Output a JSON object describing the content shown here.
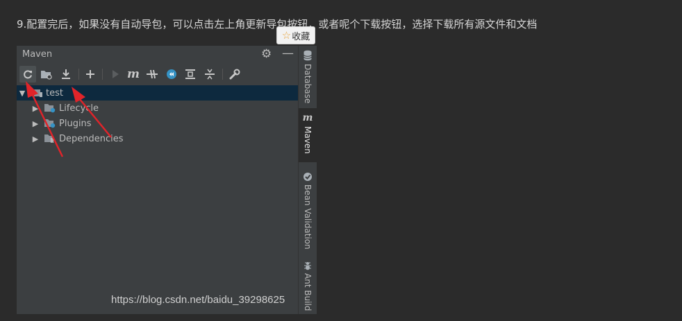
{
  "intro_text": "9.配置完后，如果没有自动导包，可以点击左上角更新导包按钮，或者呢个下载按钮，选择下载所有源文件和文档",
  "collect": {
    "star_icon": "☆",
    "label": "收藏"
  },
  "panel": {
    "title": "Maven"
  },
  "tree": {
    "root": {
      "label": "test"
    },
    "children": [
      {
        "label": "Lifecycle"
      },
      {
        "label": "Plugins"
      },
      {
        "label": "Dependencies"
      }
    ]
  },
  "side_tabs": [
    {
      "label": "Database"
    },
    {
      "label": "Maven"
    },
    {
      "label": "Bean Validation"
    },
    {
      "label": "Ant Build"
    }
  ],
  "watermark": "https://blog.csdn.net/baidu_39298625",
  "colors": {
    "background": "#2b2b2b",
    "panel": "#3c3f41",
    "selected_row": "#0d293e",
    "annotation_red": "#e0242a",
    "accent_blue": "#3592c4"
  },
  "icons": [
    "reimport-icon",
    "generate-sources-icon",
    "download-icon",
    "add-icon",
    "run-icon",
    "maven-goal-icon",
    "toggle-offline-icon",
    "skip-tests-icon",
    "show-dependencies-icon",
    "collapse-all-icon",
    "settings-wrench-icon"
  ]
}
